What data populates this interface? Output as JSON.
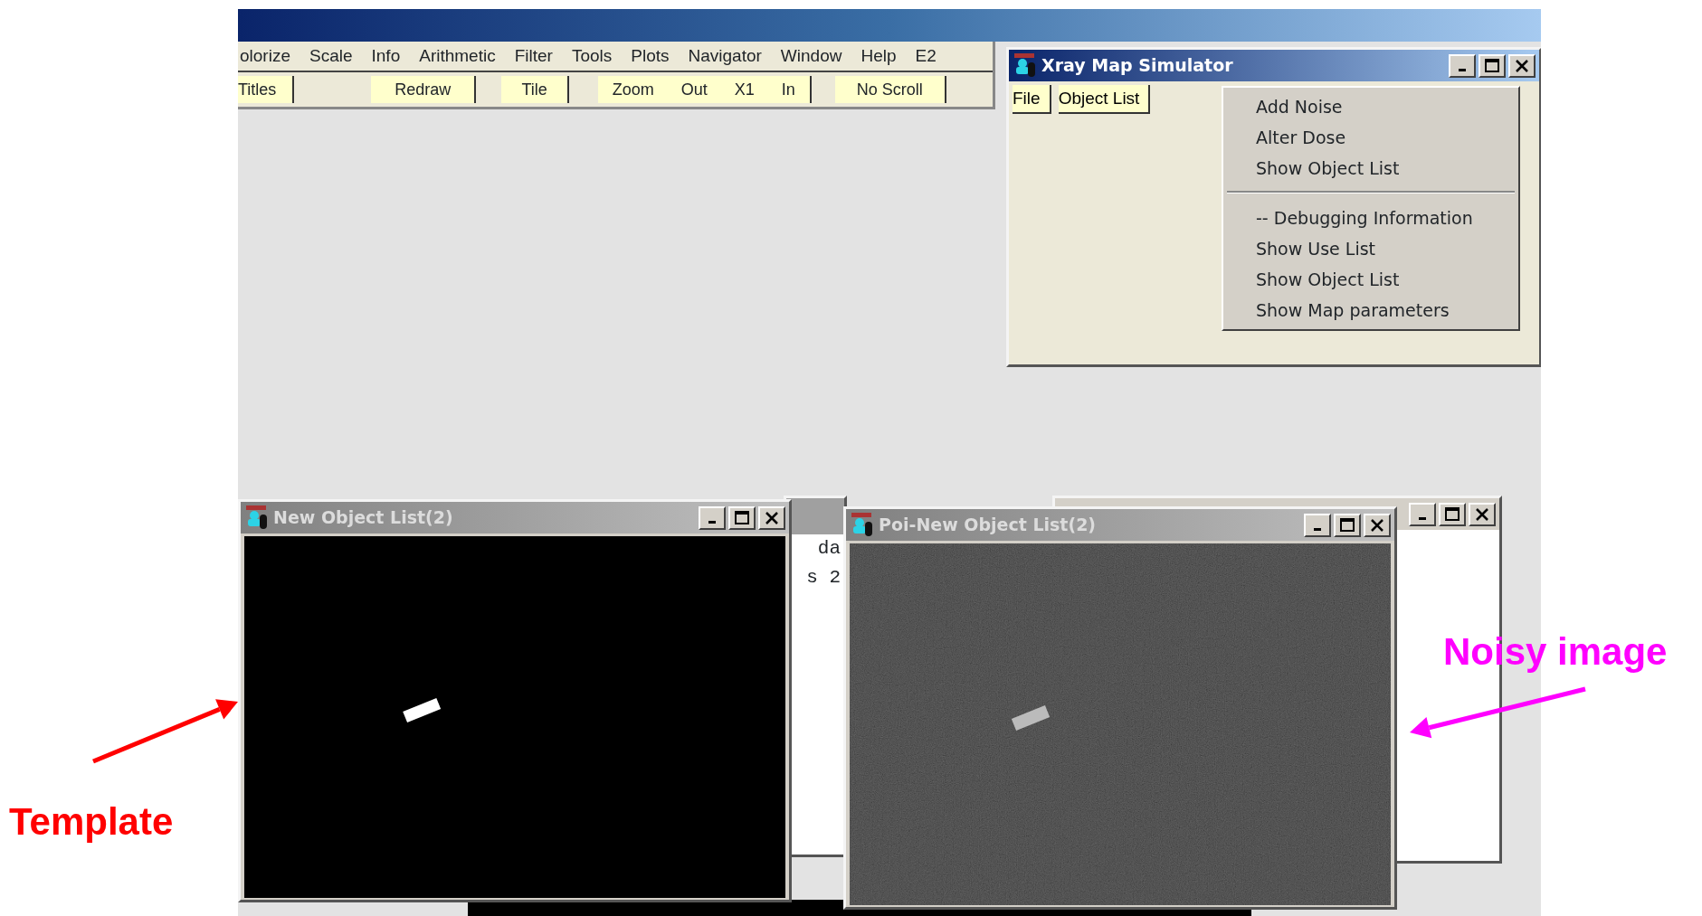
{
  "main_window": {
    "menu": [
      "olorize",
      "Scale",
      "Info",
      "Arithmetic",
      "Filter",
      "Tools",
      "Plots",
      "Navigator",
      "Window",
      "Help",
      "E2"
    ],
    "toolbar": [
      [
        "Titles"
      ],
      [
        "Redraw"
      ],
      [
        "Tile"
      ],
      [
        "Zoom",
        "Out",
        "X1",
        "In"
      ],
      [
        "No Scroll"
      ]
    ]
  },
  "simulator_window": {
    "title": "Xray Map Simulator",
    "active": true,
    "menu": [
      "File",
      "Object List"
    ],
    "dropdown": [
      {
        "kind": "item",
        "label": "Add Noise"
      },
      {
        "kind": "item",
        "label": "Alter Dose"
      },
      {
        "kind": "item",
        "label": "Show Object List"
      },
      {
        "kind": "separator"
      },
      {
        "kind": "item",
        "label": "-- Debugging Information"
      },
      {
        "kind": "item",
        "label": "Show Use List"
      },
      {
        "kind": "item",
        "label": "Show Object List"
      },
      {
        "kind": "item",
        "label": "Show Map parameters"
      }
    ]
  },
  "image_windows": [
    {
      "title": "New Object List(2)",
      "active": false
    },
    {
      "title": "Poi-New Object List(2)",
      "active": false
    }
  ],
  "text_window": {
    "lines": [
      "da",
      "s 2"
    ]
  },
  "annotations": [
    {
      "text": "Template",
      "color": "#ff0000"
    },
    {
      "text": "Noisy image",
      "color": "#ff00ff"
    }
  ]
}
